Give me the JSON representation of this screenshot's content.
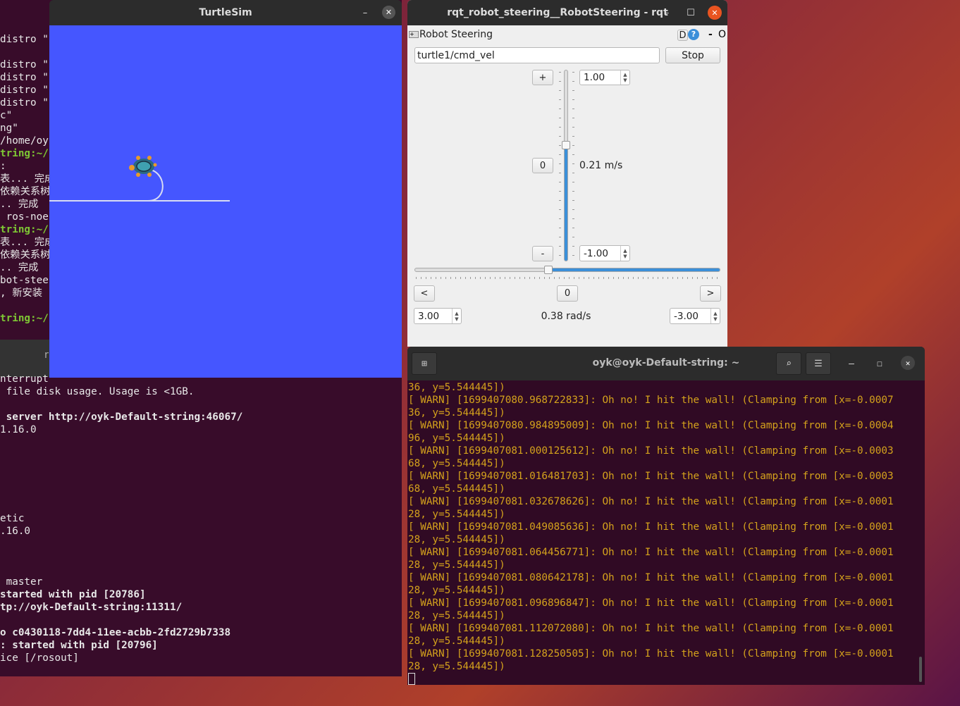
{
  "left_terminal_top": {
    "lines": [
      {
        "row": 0,
        "text": "distro \""
      },
      {
        "row": 2,
        "text": "distro \""
      },
      {
        "row": 3,
        "text": "distro \""
      },
      {
        "row": 4,
        "text": "distro \""
      },
      {
        "row": 5,
        "text": "distro \""
      },
      {
        "row": 6,
        "text": "c\""
      },
      {
        "row": 7,
        "text": "ng\""
      },
      {
        "row": 8,
        "text": "/home/oy"
      },
      {
        "row": 9,
        "text": "tring:~/",
        "style": "prompt"
      },
      {
        "row": 10,
        "text": ":"
      },
      {
        "row": 11,
        "text": "表... 完成"
      },
      {
        "row": 12,
        "text": "依赖关系树"
      },
      {
        "row": 13,
        "text": ".. 完成"
      },
      {
        "row": 14,
        "text": " ros-noe"
      },
      {
        "row": 15,
        "text": "tring:~/",
        "style": "prompt"
      },
      {
        "row": 16,
        "text": "表... 完成"
      },
      {
        "row": 17,
        "text": "依赖关系树"
      },
      {
        "row": 18,
        "text": ".. 完成"
      },
      {
        "row": 19,
        "text": "bot-stee"
      },
      {
        "row": 20,
        "text": ", 新安装"
      },
      {
        "row": 22,
        "text": "tring:~/",
        "style": "prompt"
      }
    ]
  },
  "left_terminal_bottom": {
    "title_fragment": "r",
    "lines": [
      {
        "row": 0,
        "text": "nterrupt"
      },
      {
        "row": 1,
        "text": " file disk usage. Usage is <1GB."
      },
      {
        "row": 3,
        "text": " server http://oyk-Default-string:46067/",
        "style": "bold"
      },
      {
        "row": 4,
        "text": "1.16.0"
      },
      {
        "row": 11,
        "text": "etic"
      },
      {
        "row": 12,
        "text": ".16.0"
      },
      {
        "row": 16,
        "text": " master"
      },
      {
        "row": 17,
        "text": "started with pid [20786]",
        "style": "bold"
      },
      {
        "row": 18,
        "text": "tp://oyk-Default-string:11311/",
        "style": "bold"
      },
      {
        "row": 20,
        "text": "o c0430118-7dd4-11ee-acbb-2fd2729b7338",
        "style": "bold"
      },
      {
        "row": 21,
        "text": ": started with pid [20796]",
        "style": "bold"
      },
      {
        "row": 22,
        "text": "ice [/rosout]"
      }
    ]
  },
  "turtlesim": {
    "title": "TurtleSim",
    "background_color": "#4556ff",
    "minimize_icon": "minimize-icon",
    "close_icon": "close-icon"
  },
  "rqt": {
    "title": "rqt_robot_steering__RobotSteering - rqt",
    "plugin_title": "Robot Steering",
    "plugin_buttons": {
      "d": "D",
      "help": "?",
      "minus": "-",
      "o": "O"
    },
    "topic_value": "turtle1/cmd_vel",
    "stop_label": "Stop",
    "linear": {
      "plus_label": "+",
      "zero_label": "0",
      "minus_label": "-",
      "max_value": "1.00",
      "min_value": "-1.00",
      "current_label": "0.21 m/s",
      "slider_value": 0.21
    },
    "angular": {
      "left_label": "<",
      "zero_label": "0",
      "right_label": ">",
      "max_value": "3.00",
      "min_value": "-3.00",
      "current_label": "0.38 rad/s",
      "slider_value": 0.38
    },
    "accent_color": "#3b8fd9"
  },
  "right_terminal": {
    "title": "oyk@oyk-Default-string: ~",
    "lines": [
      "36, y=5.544445])",
      "[ WARN] [1699407080.968722833]: Oh no! I hit the wall! (Clamping from [x=-0.0007",
      "36, y=5.544445])",
      "[ WARN] [1699407080.984895009]: Oh no! I hit the wall! (Clamping from [x=-0.0004",
      "96, y=5.544445])",
      "[ WARN] [1699407081.000125612]: Oh no! I hit the wall! (Clamping from [x=-0.0003",
      "68, y=5.544445])",
      "[ WARN] [1699407081.016481703]: Oh no! I hit the wall! (Clamping from [x=-0.0003",
      "68, y=5.544445])",
      "[ WARN] [1699407081.032678626]: Oh no! I hit the wall! (Clamping from [x=-0.0001",
      "28, y=5.544445])",
      "[ WARN] [1699407081.049085636]: Oh no! I hit the wall! (Clamping from [x=-0.0001",
      "28, y=5.544445])",
      "[ WARN] [1699407081.064456771]: Oh no! I hit the wall! (Clamping from [x=-0.0001",
      "28, y=5.544445])",
      "[ WARN] [1699407081.080642178]: Oh no! I hit the wall! (Clamping from [x=-0.0001",
      "28, y=5.544445])",
      "[ WARN] [1699407081.096896847]: Oh no! I hit the wall! (Clamping from [x=-0.0001",
      "28, y=5.544445])",
      "[ WARN] [1699407081.112072080]: Oh no! I hit the wall! (Clamping from [x=-0.0001",
      "28, y=5.544445])",
      "[ WARN] [1699407081.128250505]: Oh no! I hit the wall! (Clamping from [x=-0.0001",
      "28, y=5.544445])"
    ]
  }
}
